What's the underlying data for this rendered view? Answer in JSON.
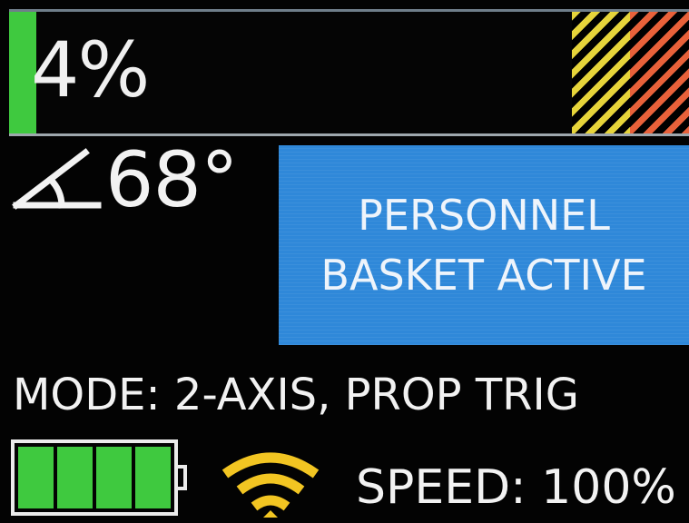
{
  "load": {
    "percent_label": "4%",
    "fill_percent": 4
  },
  "angle": {
    "icon": "boom-angle-icon",
    "value": "68°"
  },
  "status": {
    "line1": "PERSONNEL",
    "line2": "BASKET ACTIVE"
  },
  "mode": {
    "text": "MODE: 2-AXIS, PROP TRIG"
  },
  "battery": {
    "icon": "battery-icon",
    "cells_total": 4,
    "cells_filled": 4
  },
  "signal": {
    "icon": "wifi-signal-icon"
  },
  "speed": {
    "text": "SPEED: 100%"
  },
  "colors": {
    "background": "#000000",
    "fill_green": "#3fc93f",
    "banner_blue": "#2f88d9",
    "hazard_yellow": "#e6d43a",
    "hazard_red": "#e8613a",
    "wifi_yellow": "#f2c522",
    "text": "#f2f2f2"
  }
}
